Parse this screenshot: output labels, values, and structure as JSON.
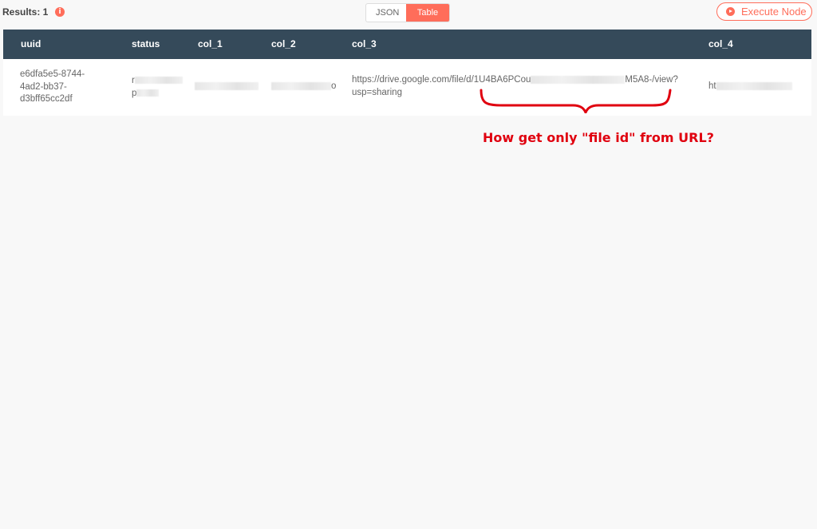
{
  "header": {
    "results_label": "Results: 1",
    "info_icon": "info-icon",
    "info_glyph": "i",
    "view_modes": [
      "JSON",
      "Table"
    ],
    "active_mode": "Table",
    "execute_button": "Execute Node",
    "accent_color": "#ff6d5a"
  },
  "table": {
    "columns": [
      "uuid",
      "status",
      "col_1",
      "col_2",
      "col_3",
      "col_4"
    ],
    "rows": [
      {
        "uuid_line1": "e6dfa5e5-8744-",
        "uuid_line2": "4ad2-bb37-",
        "uuid_line3": "d3bff65cc2df",
        "status_visible_char1": "r",
        "status_visible_char2": "p",
        "col_2_visible_tail": "o",
        "col_3_prefix": "https://drive.google.com/file/d/1U4BA6PCou",
        "col_3_suffix": "M5A8-/view?",
        "col_3_line2": "usp=sharing",
        "col_4_visible_prefix": "ht"
      }
    ],
    "header_color": "#354a5a"
  },
  "annotation": {
    "text": "How get only \"file id\" from URL?",
    "color": "#e0000f"
  }
}
